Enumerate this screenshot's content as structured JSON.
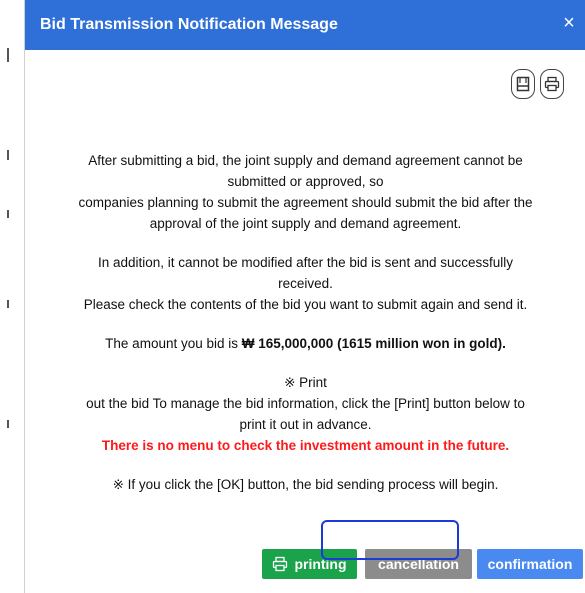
{
  "dialog": {
    "title": "Bid Transmission Notification Message",
    "close_icon": "×"
  },
  "toolbar": {
    "save_icon": "save-icon",
    "print_icon": "print-icon"
  },
  "content": {
    "para1_line1": "After submitting a bid, the joint supply and demand agreement cannot be",
    "para1_line2": "submitted or approved, so",
    "para1_line3": "companies planning to submit the agreement should submit the bid after the",
    "para1_line4": "approval of the joint supply and demand agreement.",
    "para2_line1": "In addition, it cannot be modified after the bid is sent and successfully",
    "para2_line2": "received.",
    "para2_line3": "Please check the contents of the bid you want to submit again and send it.",
    "amount_prefix": "The amount you bid is ",
    "amount_value": "₩ 165,000,000 (1615 million won in gold).",
    "print_note_title": "※ Print",
    "print_note_line1": "out the bid To manage the bid information, click the [Print] button below to",
    "print_note_line2": "print it out in advance.",
    "warning": "There is no menu to check the investment amount in the future.",
    "ok_note": "※ If you click the [OK] button, the bid sending process will begin."
  },
  "buttons": {
    "print_label": "printing",
    "cancel_label": "cancellation",
    "confirm_label": "confirmation"
  },
  "colors": {
    "titlebar": "#2f6fd8",
    "print_btn": "#1aa34a",
    "cancel_btn": "#8c8c8c",
    "confirm_btn": "#4a8af0",
    "warning_text": "#ff1a1a",
    "highlight_box": "#1a3bd6"
  }
}
